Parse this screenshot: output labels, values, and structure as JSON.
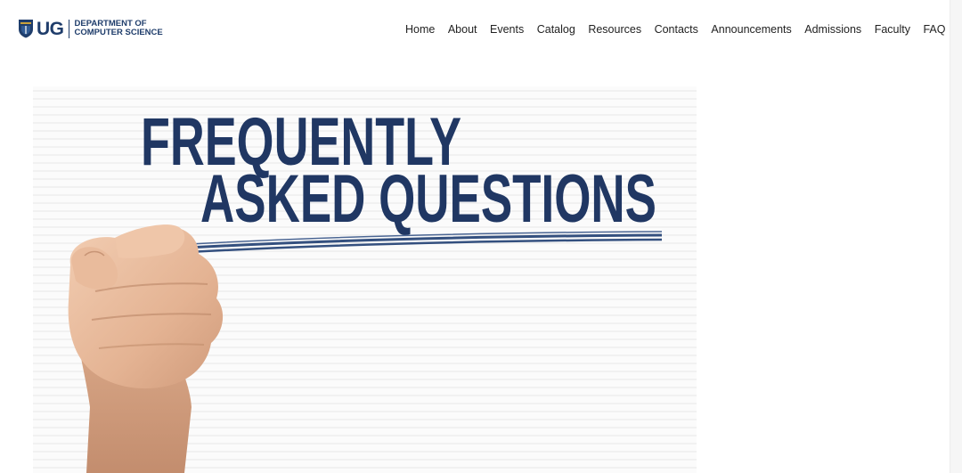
{
  "logo": {
    "mark": "UG",
    "line1": "DEPARTMENT OF",
    "line2": "COMPUTER SCIENCE",
    "crest_icon": "university-crest-icon"
  },
  "nav": [
    {
      "label": "Home"
    },
    {
      "label": "About"
    },
    {
      "label": "Events"
    },
    {
      "label": "Catalog"
    },
    {
      "label": "Resources"
    },
    {
      "label": "Contacts"
    },
    {
      "label": "Announcements"
    },
    {
      "label": "Admissions"
    },
    {
      "label": "Faculty"
    },
    {
      "label": "FAQ"
    }
  ],
  "hero": {
    "line1": "FREQUENTLY",
    "line2": "ASKED QUESTIONS",
    "image_subject": "hand-with-marker-underlining-text"
  },
  "colors": {
    "brand_navy": "#1f3d6b",
    "headline_navy": "#203763",
    "nav_text": "#222222",
    "background": "#ffffff"
  }
}
